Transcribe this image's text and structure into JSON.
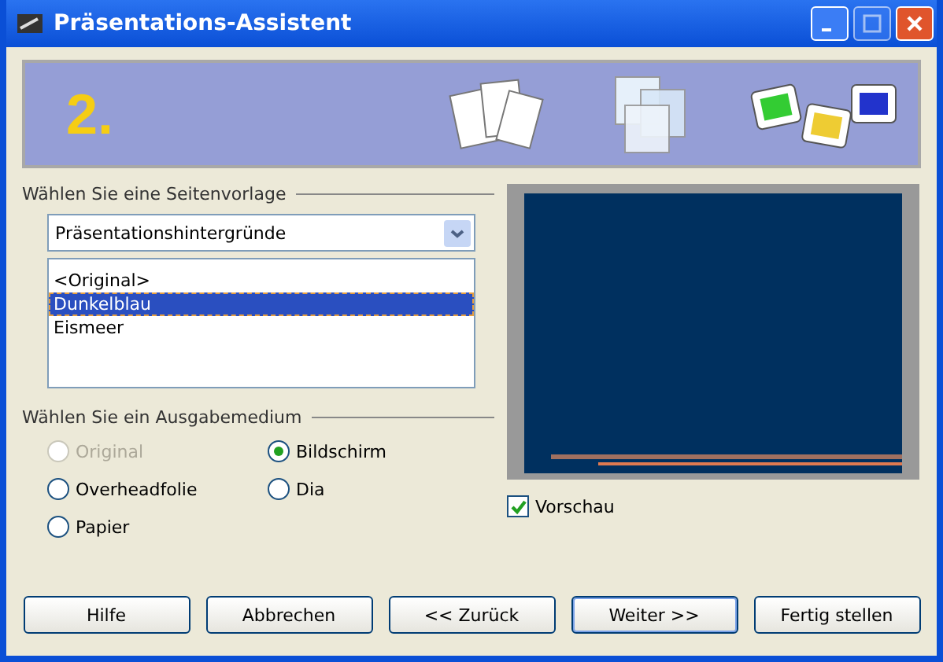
{
  "window": {
    "title": "Präsentations-Assistent"
  },
  "banner": {
    "step": "2."
  },
  "template_group": {
    "legend": "Wählen Sie eine Seitenvorlage",
    "dropdown": {
      "value": "Präsentationshintergründe"
    },
    "items": [
      {
        "label": "<Original>",
        "selected": false
      },
      {
        "label": "Dunkelblau",
        "selected": true
      },
      {
        "label": "Eismeer",
        "selected": false
      }
    ]
  },
  "medium_group": {
    "legend": "Wählen Sie ein Ausgabemedium",
    "options": [
      {
        "label": "Original",
        "selected": false,
        "disabled": true
      },
      {
        "label": "Bildschirm",
        "selected": true,
        "disabled": false
      },
      {
        "label": "Overheadfolie",
        "selected": false,
        "disabled": false
      },
      {
        "label": "Dia",
        "selected": false,
        "disabled": false
      },
      {
        "label": "Papier",
        "selected": false,
        "disabled": false
      }
    ]
  },
  "preview": {
    "checkbox": {
      "label": "Vorschau",
      "checked": true
    }
  },
  "buttons": [
    {
      "label": "Hilfe",
      "default": false
    },
    {
      "label": "Abbrechen",
      "default": false
    },
    {
      "label": "<< Zurück",
      "default": false
    },
    {
      "label": "Weiter >>",
      "default": true
    },
    {
      "label": "Fertig stellen",
      "default": false
    }
  ]
}
